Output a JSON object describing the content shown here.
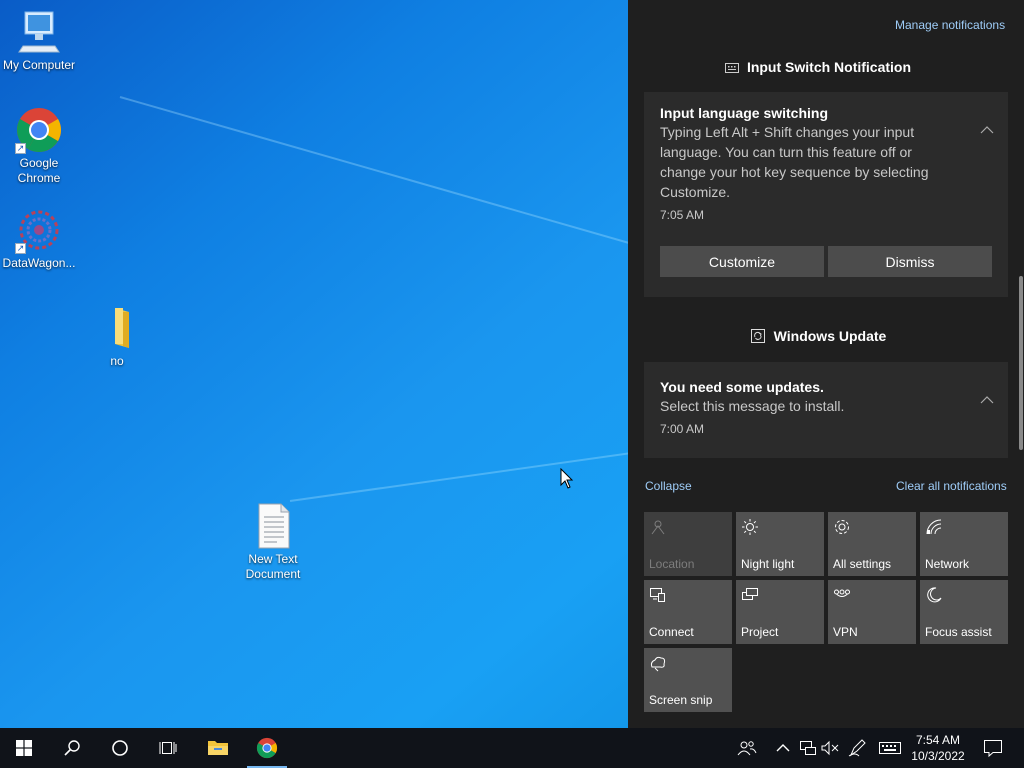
{
  "desktop": {
    "icons": [
      {
        "label": "My Computer",
        "icon": "computer-icon"
      },
      {
        "label": "Google Chrome",
        "icon": "chrome-icon",
        "shortcut": true
      },
      {
        "label": "DataWagon...",
        "icon": "datawagon-icon",
        "shortcut": true
      },
      {
        "label": "no",
        "icon": "folder-icon"
      },
      {
        "label": "New Text Document",
        "icon": "text-document-icon"
      }
    ]
  },
  "action_center": {
    "manage_link": "Manage notifications",
    "groups": [
      {
        "title": "Input Switch Notification",
        "icon": "keyboard-icon",
        "notification": {
          "title": "Input language switching",
          "body": "Typing Left Alt + Shift changes your input language. You can turn this feature off or change your hot key sequence by selecting Customize.",
          "time": "7:05 AM",
          "buttons": [
            "Customize",
            "Dismiss"
          ]
        }
      },
      {
        "title": "Windows Update",
        "icon": "update-icon",
        "notification": {
          "title": "You need some updates.",
          "body": "Select this message to install.",
          "time": "7:00 AM"
        }
      }
    ],
    "collapse_link": "Collapse",
    "clear_link": "Clear all notifications",
    "quick_actions": [
      {
        "label": "Location",
        "icon": "location-icon",
        "enabled": false
      },
      {
        "label": "Night light",
        "icon": "night-light-icon",
        "enabled": true
      },
      {
        "label": "All settings",
        "icon": "gear-icon",
        "enabled": true
      },
      {
        "label": "Network",
        "icon": "network-icon",
        "enabled": true
      },
      {
        "label": "Connect",
        "icon": "connect-icon",
        "enabled": true
      },
      {
        "label": "Project",
        "icon": "project-icon",
        "enabled": true
      },
      {
        "label": "VPN",
        "icon": "vpn-icon",
        "enabled": true
      },
      {
        "label": "Focus assist",
        "icon": "moon-icon",
        "enabled": true
      },
      {
        "label": "Screen snip",
        "icon": "screen-snip-icon",
        "enabled": true
      }
    ]
  },
  "taskbar": {
    "pinned": [
      "start-icon",
      "search-icon",
      "cortana-icon",
      "task-view-icon",
      "file-explorer-icon",
      "chrome-icon"
    ],
    "tray_icons": [
      "people-icon",
      "chevron-up-icon",
      "network-wired-icon",
      "volume-muted-icon",
      "pen-icon",
      "keyboard-icon"
    ],
    "clock": {
      "time": "7:54 AM",
      "date": "10/3/2022"
    },
    "notification_icon": "notification-icon"
  },
  "colors": {
    "accent": "#9fcdf8",
    "panel": "#1f1f1f",
    "card": "#2b2b2b",
    "tile": "#515151",
    "taskbar": "#101319"
  }
}
